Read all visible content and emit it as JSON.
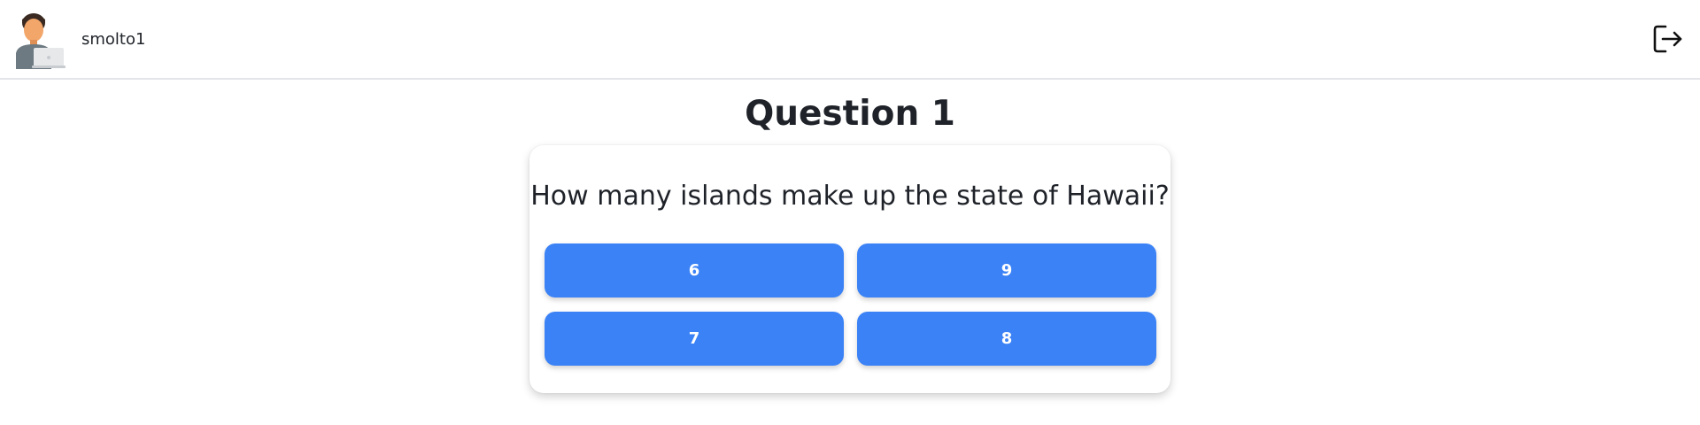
{
  "header": {
    "username": "smolto1",
    "avatar_icon": "user-with-laptop-avatar",
    "logout_icon": "logout-icon"
  },
  "quiz": {
    "title": "Question 1",
    "question": "How many islands make up the state of Hawaii?",
    "answers": [
      "6",
      "9",
      "7",
      "8"
    ],
    "button_color": "#3b82f6"
  }
}
